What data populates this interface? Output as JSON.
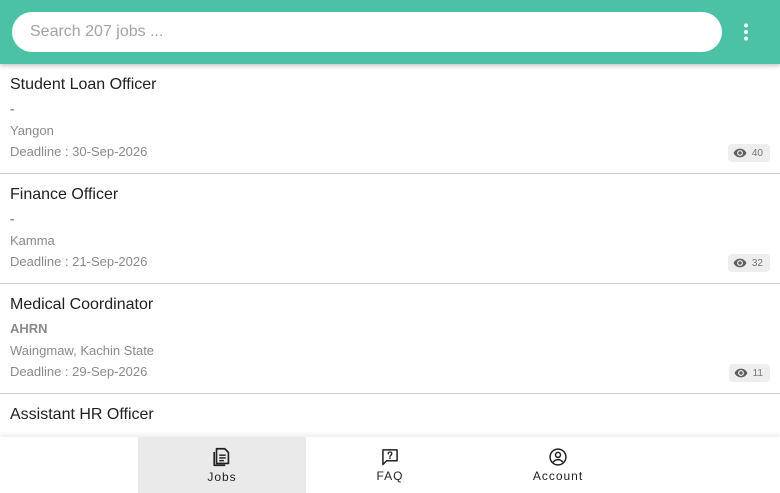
{
  "search": {
    "placeholder": "Search 207 jobs ..."
  },
  "menu": {
    "icon": "more-vert-icon"
  },
  "jobs": [
    {
      "title": "Student Loan Officer",
      "company": "-",
      "location": "Yangon",
      "deadline": "Deadline : 30-Sep-2026",
      "views": "40"
    },
    {
      "title": "Finance Officer",
      "company": "-",
      "location": "Kamma",
      "deadline": "Deadline : 21-Sep-2026",
      "views": "32"
    },
    {
      "title": "Medical Coordinator",
      "company": "AHRN",
      "location": "Waingmaw, Kachin State",
      "deadline": "Deadline : 29-Sep-2026",
      "views": "11"
    },
    {
      "title": "Assistant HR Officer",
      "company": "",
      "location": "",
      "deadline": "",
      "views": ""
    }
  ],
  "nav": {
    "jobs": {
      "label": "Jobs",
      "icon": "jobs-icon",
      "active": true
    },
    "faq": {
      "label": "FAQ",
      "icon": "faq-icon",
      "active": false
    },
    "account": {
      "label": "Account",
      "icon": "account-icon",
      "active": false
    }
  },
  "colors": {
    "header": "#4bc2a6",
    "text_primary": "#212121",
    "text_secondary": "#8a8a8a",
    "active_nav": "#eaeaea"
  }
}
